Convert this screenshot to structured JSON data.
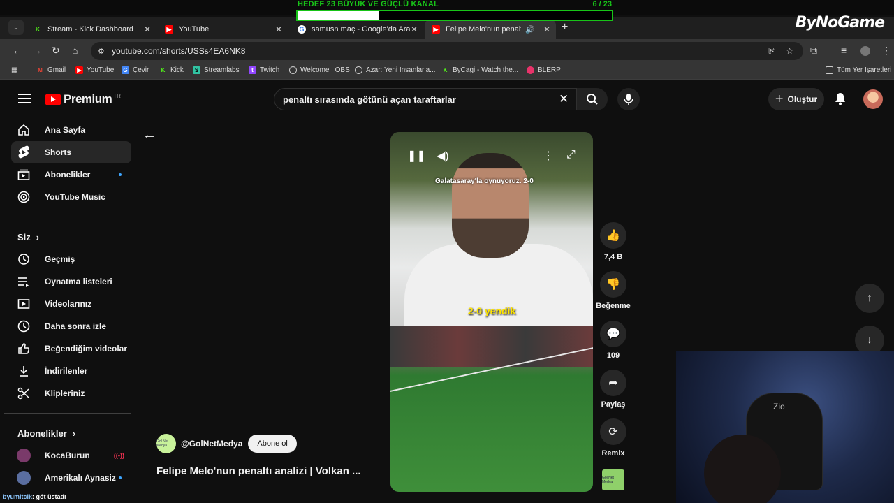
{
  "overlay": {
    "goal_text": "HEDEF 23 BÜYÜK VE GÜÇLÜ KANAL",
    "goal_count": "6 / 23",
    "goal_progress": 0.26,
    "brand": "ByNoGame"
  },
  "tabs": [
    {
      "label": "Stream - Kick Dashboard",
      "icon": "kick-icon",
      "color": "#53fc18"
    },
    {
      "label": "YouTube",
      "icon": "youtube-icon",
      "color": "#ff0000"
    },
    {
      "label": "samusn maç - Google'da Ara",
      "icon": "google-icon",
      "color": "#ffffff"
    },
    {
      "label": "Felipe Melo'nun penaltı ana",
      "icon": "youtube-icon",
      "color": "#ff0000"
    }
  ],
  "address": {
    "url": "youtube.com/shorts/USSs4EA6NK8"
  },
  "bookmarks": [
    {
      "label": "Gmail",
      "color": "#ea4335"
    },
    {
      "label": "YouTube",
      "color": "#ff0000"
    },
    {
      "label": "Çevir",
      "color": "#4285f4"
    },
    {
      "label": "Kick",
      "color": "#53fc18"
    },
    {
      "label": "Streamlabs",
      "color": "#31c3a2"
    },
    {
      "label": "Twitch",
      "color": "#9146ff"
    },
    {
      "label": "Welcome | OBS",
      "color": "#cccccc"
    },
    {
      "label": "Azar: Yeni İnsanlarla...",
      "color": "#cccccc"
    },
    {
      "label": "ByCagi - Watch the...",
      "color": "#53fc18"
    },
    {
      "label": "BLERP",
      "color": "#e8336a"
    }
  ],
  "all_bookmarks": "Tüm Yer İşaretleri",
  "yt": {
    "logo": "Premium",
    "region": "TR",
    "search_query": "penaltı sırasında götünü açan taraftarlar",
    "create": "Oluştur"
  },
  "sidebar": {
    "main": [
      {
        "label": "Ana Sayfa",
        "icon": "home-icon"
      },
      {
        "label": "Shorts",
        "icon": "shorts-icon"
      },
      {
        "label": "Abonelikler",
        "icon": "subscriptions-icon"
      },
      {
        "label": "YouTube Music",
        "icon": "music-icon"
      }
    ],
    "you_header": "Siz",
    "you": [
      {
        "label": "Geçmiş",
        "icon": "history-icon"
      },
      {
        "label": "Oynatma listeleri",
        "icon": "playlist-icon"
      },
      {
        "label": "Videolarınız",
        "icon": "your-videos-icon"
      },
      {
        "label": "Daha sonra izle",
        "icon": "clock-icon"
      },
      {
        "label": "Beğendiğim videolar",
        "icon": "like-icon"
      },
      {
        "label": "İndirilenler",
        "icon": "download-icon"
      },
      {
        "label": "Klipleriniz",
        "icon": "scissors-icon"
      }
    ],
    "subs_header": "Abonelikler",
    "subs": [
      {
        "label": "KocaBurun",
        "color": "#7a3a6a"
      },
      {
        "label": "Amerikalı Aynasiz",
        "color": "#5a6ea0"
      }
    ]
  },
  "video": {
    "caption_top": "Galatasaray'la oynuyoruz. 2-0",
    "caption_main": "2-0 yendik",
    "channel": "@GolNetMedya",
    "channel_avatar_text": "Gol Net Medya",
    "subscribe": "Abone ol",
    "title": "Felipe Melo'nun penaltı analizi | Volkan ..."
  },
  "actions": {
    "likes": "7,4 B",
    "dislike": "Beğenme",
    "comments": "109",
    "share": "Paylaş",
    "remix": "Remix"
  },
  "chat": {
    "user": "byumitcik",
    "message": ": göt üstadı"
  },
  "webcam": {
    "chair_label": "Zio"
  }
}
